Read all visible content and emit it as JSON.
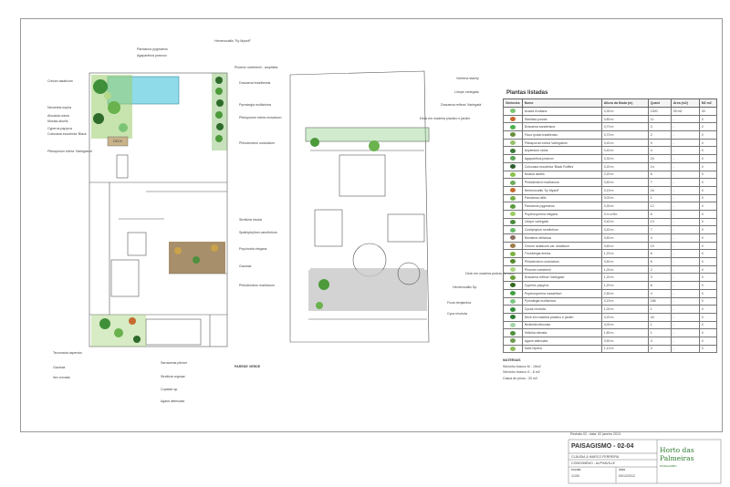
{
  "left_plan_labels": [
    {
      "id": "l01",
      "text": "Pandanus pygmaeus"
    },
    {
      "id": "l02",
      "text": "Agapanthus praecox"
    },
    {
      "id": "l03",
      "text": "Hemerocallis \"Sy Myself\""
    },
    {
      "id": "l04",
      "text": "Crinum asiaticum"
    },
    {
      "id": "l05",
      "text": "Phoenix roebelenii - amphibia"
    },
    {
      "id": "l06",
      "text": "Neoreleia kopha"
    },
    {
      "id": "l07",
      "text": "Alocasia odora"
    },
    {
      "id": "l08",
      "text": "Mosisa aluelis"
    },
    {
      "id": "l09",
      "text": "Dracaena braziliensis"
    },
    {
      "id": "l10",
      "text": "Cyperus papyrus"
    },
    {
      "id": "l11",
      "text": "Pyrostegia mollisnima"
    },
    {
      "id": "l12",
      "text": "Colocasia esculenta 'Black"
    },
    {
      "id": "l13",
      "text": "Pittosporum tobira mosaicum"
    },
    {
      "id": "l14",
      "text": "Pittosporum tobira 'Variegatum'"
    },
    {
      "id": "l15",
      "text": "Philodendron undulatum"
    },
    {
      "id": "l16",
      "text": "Strelitzia nicolai"
    },
    {
      "id": "l17",
      "text": "Spathiphyllum cannifolium"
    },
    {
      "id": "l18",
      "text": "Psychotria elegans"
    },
    {
      "id": "l19",
      "text": "Gazania"
    },
    {
      "id": "l20",
      "text": "Philodendron martianum"
    },
    {
      "id": "l21",
      "text": "Tecomaria capensis"
    },
    {
      "id": "l22",
      "text": "Gazania"
    },
    {
      "id": "l23",
      "text": "Ilex crenata"
    },
    {
      "id": "l24",
      "text": "Sarracenia pitcher"
    },
    {
      "id": "l25",
      "text": "Strelitzia reginae"
    },
    {
      "id": "l26",
      "text": "Cupidae sp."
    },
    {
      "id": "l27",
      "text": "Agave attenuata"
    },
    {
      "id": "l28",
      "text": "PAREDE VERDE"
    },
    {
      "id": "l29",
      "text": "DECK"
    }
  ],
  "right_plan_labels": [
    {
      "id": "r01",
      "text": "Verbena stachy"
    },
    {
      "id": "r02",
      "text": "Liriope variegata"
    },
    {
      "id": "r03",
      "text": "Dracaena reflexa 'Variegata'"
    },
    {
      "id": "r04",
      "text": "Deck em madeira plastico e jardim"
    },
    {
      "id": "r05",
      "text": "Deck em madeira pedras do vaso"
    },
    {
      "id": "r06",
      "text": "Hemerocallis Sp."
    },
    {
      "id": "r07",
      "text": "Ficus benjamina"
    },
    {
      "id": "r08",
      "text": "Cyca revoluta"
    }
  ],
  "table": {
    "title": "Plantas listadas",
    "headers": [
      "Símbolos",
      "Nome",
      "Altura da Muda (m)",
      "Quant",
      "Área (m2)",
      "M2 m2"
    ],
    "rows": [
      {
        "color": "#7cc576",
        "name": "Acacia rivuliana",
        "height": "0,30 m",
        "qty": "1000",
        "area": "30 m2",
        "m2": "30"
      },
      {
        "color": "#c9662e",
        "name": "Strelitzia juncea",
        "height": "0,80 m",
        "qty": "11",
        "area": "-",
        "m2": "0"
      },
      {
        "color": "#4caf50",
        "name": "Dracaena sanderiana",
        "height": "0,70 m",
        "qty": "3",
        "area": "-",
        "m2": "0"
      },
      {
        "color": "#6a8f3a",
        "name": "Ficus lyrata brasiliensis",
        "height": "0,70 m",
        "qty": "2",
        "area": "-",
        "m2": "0"
      },
      {
        "color": "#98c26a",
        "name": "Pittosporum tobira Variegatum",
        "height": "0,40 m",
        "qty": "9",
        "area": "-",
        "m2": "0"
      },
      {
        "color": "#3d7a3a",
        "name": "Asplenium nidus",
        "height": "0,40 m",
        "qty": "4",
        "area": "-",
        "m2": "0"
      },
      {
        "color": "#5aa55a",
        "name": "Agapanthus praecox",
        "height": "0,30 m",
        "qty": "24",
        "area": "-",
        "m2": "0"
      },
      {
        "color": "#2e5d2e",
        "name": "Colocasia esculenta 'Black Ruffles'",
        "height": "0,20 m",
        "qty": "14",
        "area": "-",
        "m2": "0"
      },
      {
        "color": "#8bc34a",
        "name": "Mosisa aluelis",
        "height": "2,20 m",
        "qty": "6",
        "area": "-",
        "m2": "0"
      },
      {
        "color": "#6cae5f",
        "name": "Philodendron martianum",
        "height": "0,60 m",
        "qty": "7",
        "area": "-",
        "m2": "0"
      },
      {
        "color": "#c46b2e",
        "name": "Hemerocallis 'Sy Myself'",
        "height": "0,15 m",
        "qty": "16",
        "area": "-",
        "m2": "0"
      },
      {
        "color": "#76b04a",
        "name": "Pandanus utilis",
        "height": "3,00 m",
        "qty": "1",
        "area": "-",
        "m2": "0"
      },
      {
        "color": "#5c9a3d",
        "name": "Pandanus pygmaeus",
        "height": "0,30 m",
        "qty": "12",
        "area": "-",
        "m2": "0"
      },
      {
        "color": "#9ccc65",
        "name": "Psychosperma elegans",
        "height": "3 m a 5m",
        "qty": "6",
        "area": "-",
        "m2": "0"
      },
      {
        "color": "#4a8a3f",
        "name": "Liriope variegata",
        "height": "0,40 m",
        "qty": "13",
        "area": "-",
        "m2": "0"
      },
      {
        "color": "#66bb6a",
        "name": "Costiphylum semitolium",
        "height": "0,40 m",
        "qty": "7",
        "area": "-",
        "m2": "0"
      },
      {
        "color": "#8d6e63",
        "name": "Monstera deliciosa",
        "height": "0,50 m",
        "qty": "4",
        "area": "-",
        "m2": "0"
      },
      {
        "color": "#9e7c4b",
        "name": "Crinum asiaticum var. asiaticum",
        "height": "0,60 m",
        "qty": "10",
        "area": "-",
        "m2": "0"
      },
      {
        "color": "#7cb342",
        "name": "Thunbergia erecta",
        "height": "1,20 m",
        "qty": "6",
        "area": "-",
        "m2": "0"
      },
      {
        "color": "#558b2f",
        "name": "Philodendron undulatum",
        "height": "0,50 m",
        "qty": "6",
        "area": "-",
        "m2": "0"
      },
      {
        "color": "#aed581",
        "name": "Phoenix roebelenii",
        "height": "1,00 m",
        "qty": "2",
        "area": "-",
        "m2": "0"
      },
      {
        "color": "#689f38",
        "name": "Dracaena reflexa 'Variegata'",
        "height": "1,20 m",
        "qty": "3",
        "area": "-",
        "m2": "0"
      },
      {
        "color": "#33691e",
        "name": "Cyperus papyrus",
        "height": "1,20 m",
        "qty": "6",
        "area": "-",
        "m2": "0"
      },
      {
        "color": "#43a047",
        "name": "Psychosperma macarthuri",
        "height": "2,50 m",
        "qty": "4",
        "area": "-",
        "m2": "0"
      },
      {
        "color": "#81c784",
        "name": "Pyrostegia mollisnima",
        "height": "0,15 m",
        "qty": "165",
        "area": "-",
        "m2": "0"
      },
      {
        "color": "#388e3c",
        "name": "Cycas revoluta",
        "height": "1,00 m",
        "qty": "1",
        "area": "-",
        "m2": "0"
      },
      {
        "color": "#2e7d32",
        "name": "Deck em madeira plastico e jardim",
        "height": "0,20 m",
        "qty": "44",
        "area": "-",
        "m2": "0"
      },
      {
        "color": "#a5d6a7",
        "name": "Nedbella bifurcata",
        "height": "4,00 m",
        "qty": "1",
        "area": "-",
        "m2": "0"
      },
      {
        "color": "#4e8f3e",
        "name": "Velichia elenata",
        "height": "1,80 m",
        "qty": "1",
        "area": "-",
        "m2": "0"
      },
      {
        "color": "#6d9c4f",
        "name": "Agave attenuata",
        "height": "0,50 m",
        "qty": "3",
        "area": "-",
        "m2": "0"
      },
      {
        "color": "#8fbc5c",
        "name": "Salix repens",
        "height": "1,10 m",
        "qty": "3",
        "area": "-",
        "m2": "0"
      }
    ]
  },
  "materials": {
    "title": "MATERIAIS",
    "lines": [
      "Seixinho branco M - 15m2",
      "Seixinho branco G - 8 m2",
      "Casca de pinus - 20 m2"
    ]
  },
  "title_block": {
    "top_note": "Revisão 02 - data: 02 janeiro 2013",
    "title": "PAISAGISMO - 02-04",
    "client": "CLÁUDIA & MARCO FERREIRA",
    "address": "CONDOMÍNIO - ALPHAVILLE",
    "scale_label": "escala",
    "scale": "1/100",
    "date_label": "data",
    "date": "09/12/2012",
    "logo_line1": "Horto das",
    "logo_line2": "Palmeiras",
    "logo_sub": "PAISAGISMO"
  },
  "colors": {
    "pool": "#7fd4e8",
    "plant_green": "#5daa3c",
    "dark_green": "#2e6b2a",
    "deck_brown": "#8a6a3a"
  }
}
